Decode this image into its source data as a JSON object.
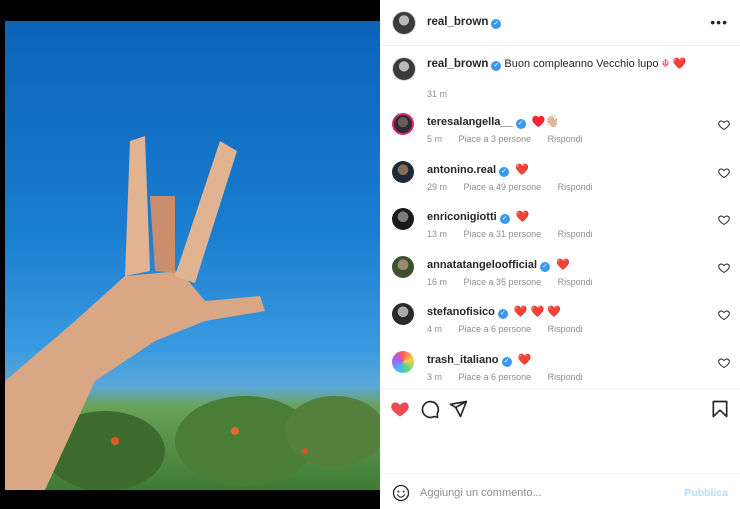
{
  "post": {
    "author": "real_brown",
    "caption_text": "Buon compleanno Vecchio lupo",
    "caption_emoji": "☬️ ❤️",
    "caption_time": "31 m"
  },
  "comments": [
    {
      "user": "teresalangella__",
      "text": "♥️👋🏼",
      "time": "5 m",
      "likes": "Piace a 3 persone",
      "reply": "Rispondi",
      "ring": true
    },
    {
      "user": "antonino.real",
      "text": "❤️",
      "time": "29 m",
      "likes": "Piace a 49 persone",
      "reply": "Rispondi",
      "ring": false
    },
    {
      "user": "enriconigiotti",
      "text": "❤️",
      "time": "13 m",
      "likes": "Piace a 31 persone",
      "reply": "Rispondi",
      "ring": false
    },
    {
      "user": "annatatangeloofficial",
      "text": "❤️",
      "time": "16 m",
      "likes": "Piace a 35 persone",
      "reply": "Rispondi",
      "ring": false
    },
    {
      "user": "stefanofisico",
      "text": "❤️ ❤️ ❤️",
      "time": "4 m",
      "likes": "Piace a 6 persone",
      "reply": "Rispondi",
      "ring": false
    },
    {
      "user": "trash_italiano",
      "text": "❤️",
      "time": "3 m",
      "likes": "Piace a 6 persone",
      "reply": "Rispondi",
      "ring": false
    }
  ],
  "add_comment": {
    "placeholder": "Aggiungi un commento...",
    "publish": "Pubblica"
  },
  "icons": {
    "more": "more-options-icon",
    "like": "heart-icon",
    "comment": "comment-icon",
    "share": "share-icon",
    "save": "bookmark-icon",
    "emoji": "emoji-icon"
  },
  "colors": {
    "like_active": "#ed4956",
    "verified": "#3897f0",
    "publish_disabled": "#b3dbff"
  }
}
